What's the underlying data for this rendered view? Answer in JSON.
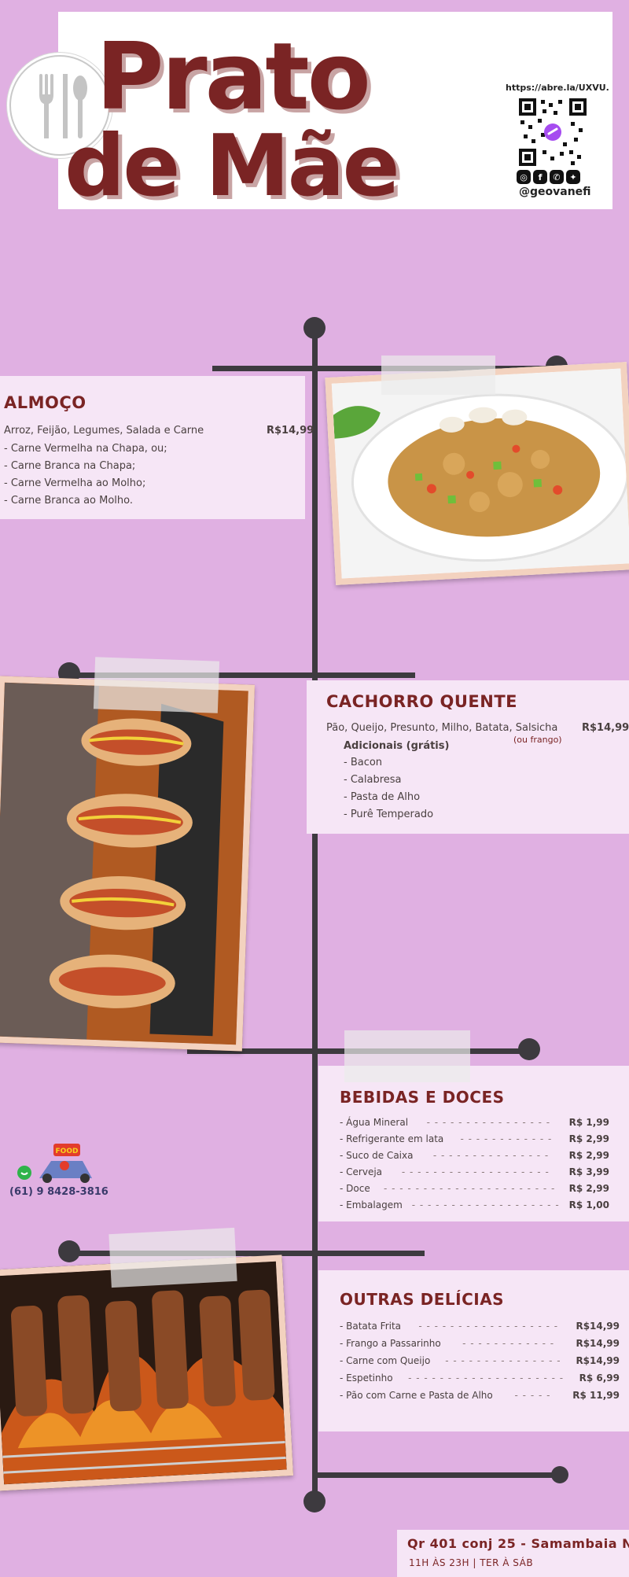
{
  "header": {
    "title_line1": "Prato",
    "title_line2": "de Mãe",
    "url": "https://abre.la/UXVU.",
    "social_icons": [
      "instagram-icon",
      "facebook-icon",
      "whatsapp-icon",
      "twitter-icon"
    ],
    "handle": "@geovanefi"
  },
  "sections": {
    "almoco": {
      "title": "ALMOÇO",
      "description": "Arroz, Feijão, Legumes, Salada e Carne",
      "price": "R$14,99",
      "options": [
        "- Carne Vermelha na Chapa, ou;",
        "- Carne Branca na Chapa;",
        "- Carne Vermelha ao Molho;",
        "- Carne Branca ao Molho."
      ]
    },
    "cachorro": {
      "title": "CACHORRO QUENTE",
      "description": "Pão, Queijo, Presunto, Milho, Batata, Salsicha",
      "note": "(ou frango)",
      "price": "R$14,99",
      "extras_title": "Adicionais (grátis)",
      "extras": [
        "- Bacon",
        "- Calabresa",
        "- Pasta de Alho",
        "- Purê Temperado"
      ]
    },
    "bebidas": {
      "title": "BEBIDAS E DOCES",
      "items": [
        {
          "name": "- Água Mineral",
          "dashes": "- - - - - - - - - - - - - - - -",
          "price": "R$ 1,99"
        },
        {
          "name": "- Refrigerante em lata",
          "dashes": "- - - - - - - - - - - -",
          "price": "R$ 2,99"
        },
        {
          "name": "- Suco de Caixa",
          "dashes": "- - - - - - - - - - - - - - -",
          "price": "R$ 2,99"
        },
        {
          "name": "- Cerveja",
          "dashes": "- - - - - - - - - - - - - - - - - - -",
          "price": "R$ 3,99"
        },
        {
          "name": "- Doce",
          "dashes": "- - - - - - - - - - - - - - - - - - - - - -",
          "price": "R$ 2,99"
        },
        {
          "name": "- Embalagem",
          "dashes": "- - - - - - - - - - - - - - - - - - -",
          "price": "R$ 1,00"
        }
      ]
    },
    "outras": {
      "title": "OUTRAS DELÍCIAS",
      "items": [
        {
          "name": "- Batata Frita",
          "dashes": "- - - - - - - - - - - - - - - - - -",
          "price": "R$14,99"
        },
        {
          "name": "- Frango a Passarinho",
          "dashes": "- - - - - - - - - - - -",
          "price": "R$14,99"
        },
        {
          "name": "- Carne com Queijo",
          "dashes": "- - - - - - - - - - - - - - -",
          "price": "R$14,99"
        },
        {
          "name": "- Espetinho",
          "dashes": "- - - - - - - - - - - - - - - - - - - -",
          "price": "R$ 6,99"
        },
        {
          "name": "- Pão com Carne e Pasta de Alho",
          "dashes": "- - - - -",
          "price": "R$ 11,99"
        }
      ]
    }
  },
  "delivery": {
    "logo_text": "FOOD DELIVERY",
    "phone": "(61) 9 8428-3816"
  },
  "footer": {
    "address": "Qr 401 conj 25 - Samambaia N.",
    "hours": "11H ÀS 23H | TER À SÁB"
  },
  "colors": {
    "background": "#e0b0e2",
    "title": "#7a2424",
    "card": "#f6e6f6",
    "timeline": "#3d3a3f"
  }
}
